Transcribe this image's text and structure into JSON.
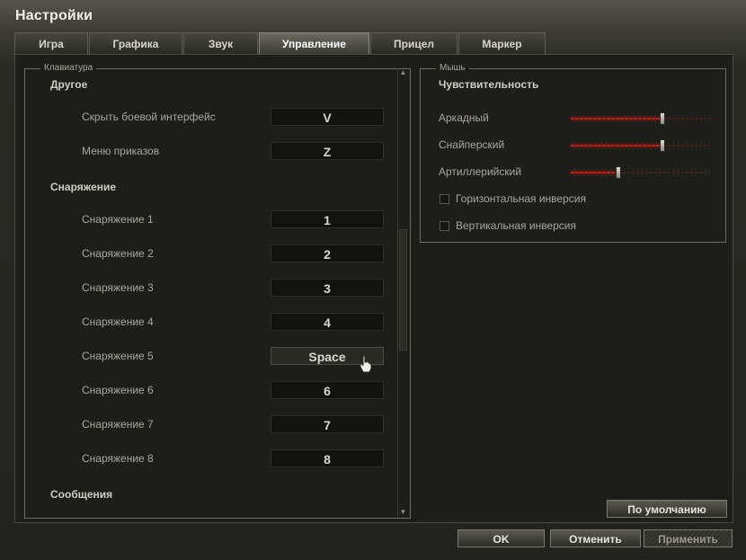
{
  "window": {
    "title": "Настройки"
  },
  "tabs": [
    {
      "label": "Игра",
      "active": false
    },
    {
      "label": "Графика",
      "active": false
    },
    {
      "label": "Звук",
      "active": false
    },
    {
      "label": "Управление",
      "active": true
    },
    {
      "label": "Прицел",
      "active": false
    },
    {
      "label": "Маркер",
      "active": false
    }
  ],
  "keyboard": {
    "legend": "Клавиатура",
    "sections": {
      "other": {
        "title": "Другое",
        "rows": [
          {
            "label": "Скрыть боевой интерфейс",
            "key": "V"
          },
          {
            "label": "Меню приказов",
            "key": "Z"
          }
        ]
      },
      "equipment": {
        "title": "Снаряжение",
        "rows": [
          {
            "label": "Снаряжение 1",
            "key": "1"
          },
          {
            "label": "Снаряжение 2",
            "key": "2"
          },
          {
            "label": "Снаряжение 3",
            "key": "3"
          },
          {
            "label": "Снаряжение 4",
            "key": "4"
          },
          {
            "label": "Снаряжение 5",
            "key": "Space"
          },
          {
            "label": "Снаряжение 6",
            "key": "6"
          },
          {
            "label": "Снаряжение 7",
            "key": "7"
          },
          {
            "label": "Снаряжение 8",
            "key": "8"
          }
        ]
      },
      "messages": {
        "title": "Сообщения"
      }
    }
  },
  "mouse": {
    "legend": "Мышь",
    "sensitivity_title": "Чувствительность",
    "sliders": [
      {
        "label": "Аркадный",
        "value": 0.66
      },
      {
        "label": "Снайперский",
        "value": 0.66
      },
      {
        "label": "Артиллерийский",
        "value": 0.34
      }
    ],
    "checkboxes": [
      {
        "label": "Горизонтальная инверсия",
        "checked": false
      },
      {
        "label": "Вертикальная инверсия",
        "checked": false
      }
    ]
  },
  "buttons": {
    "default": "По умолчанию",
    "ok": "OK",
    "cancel": "Отменить",
    "apply": "Применить"
  },
  "colors": {
    "accent_red": "#c21a12"
  }
}
